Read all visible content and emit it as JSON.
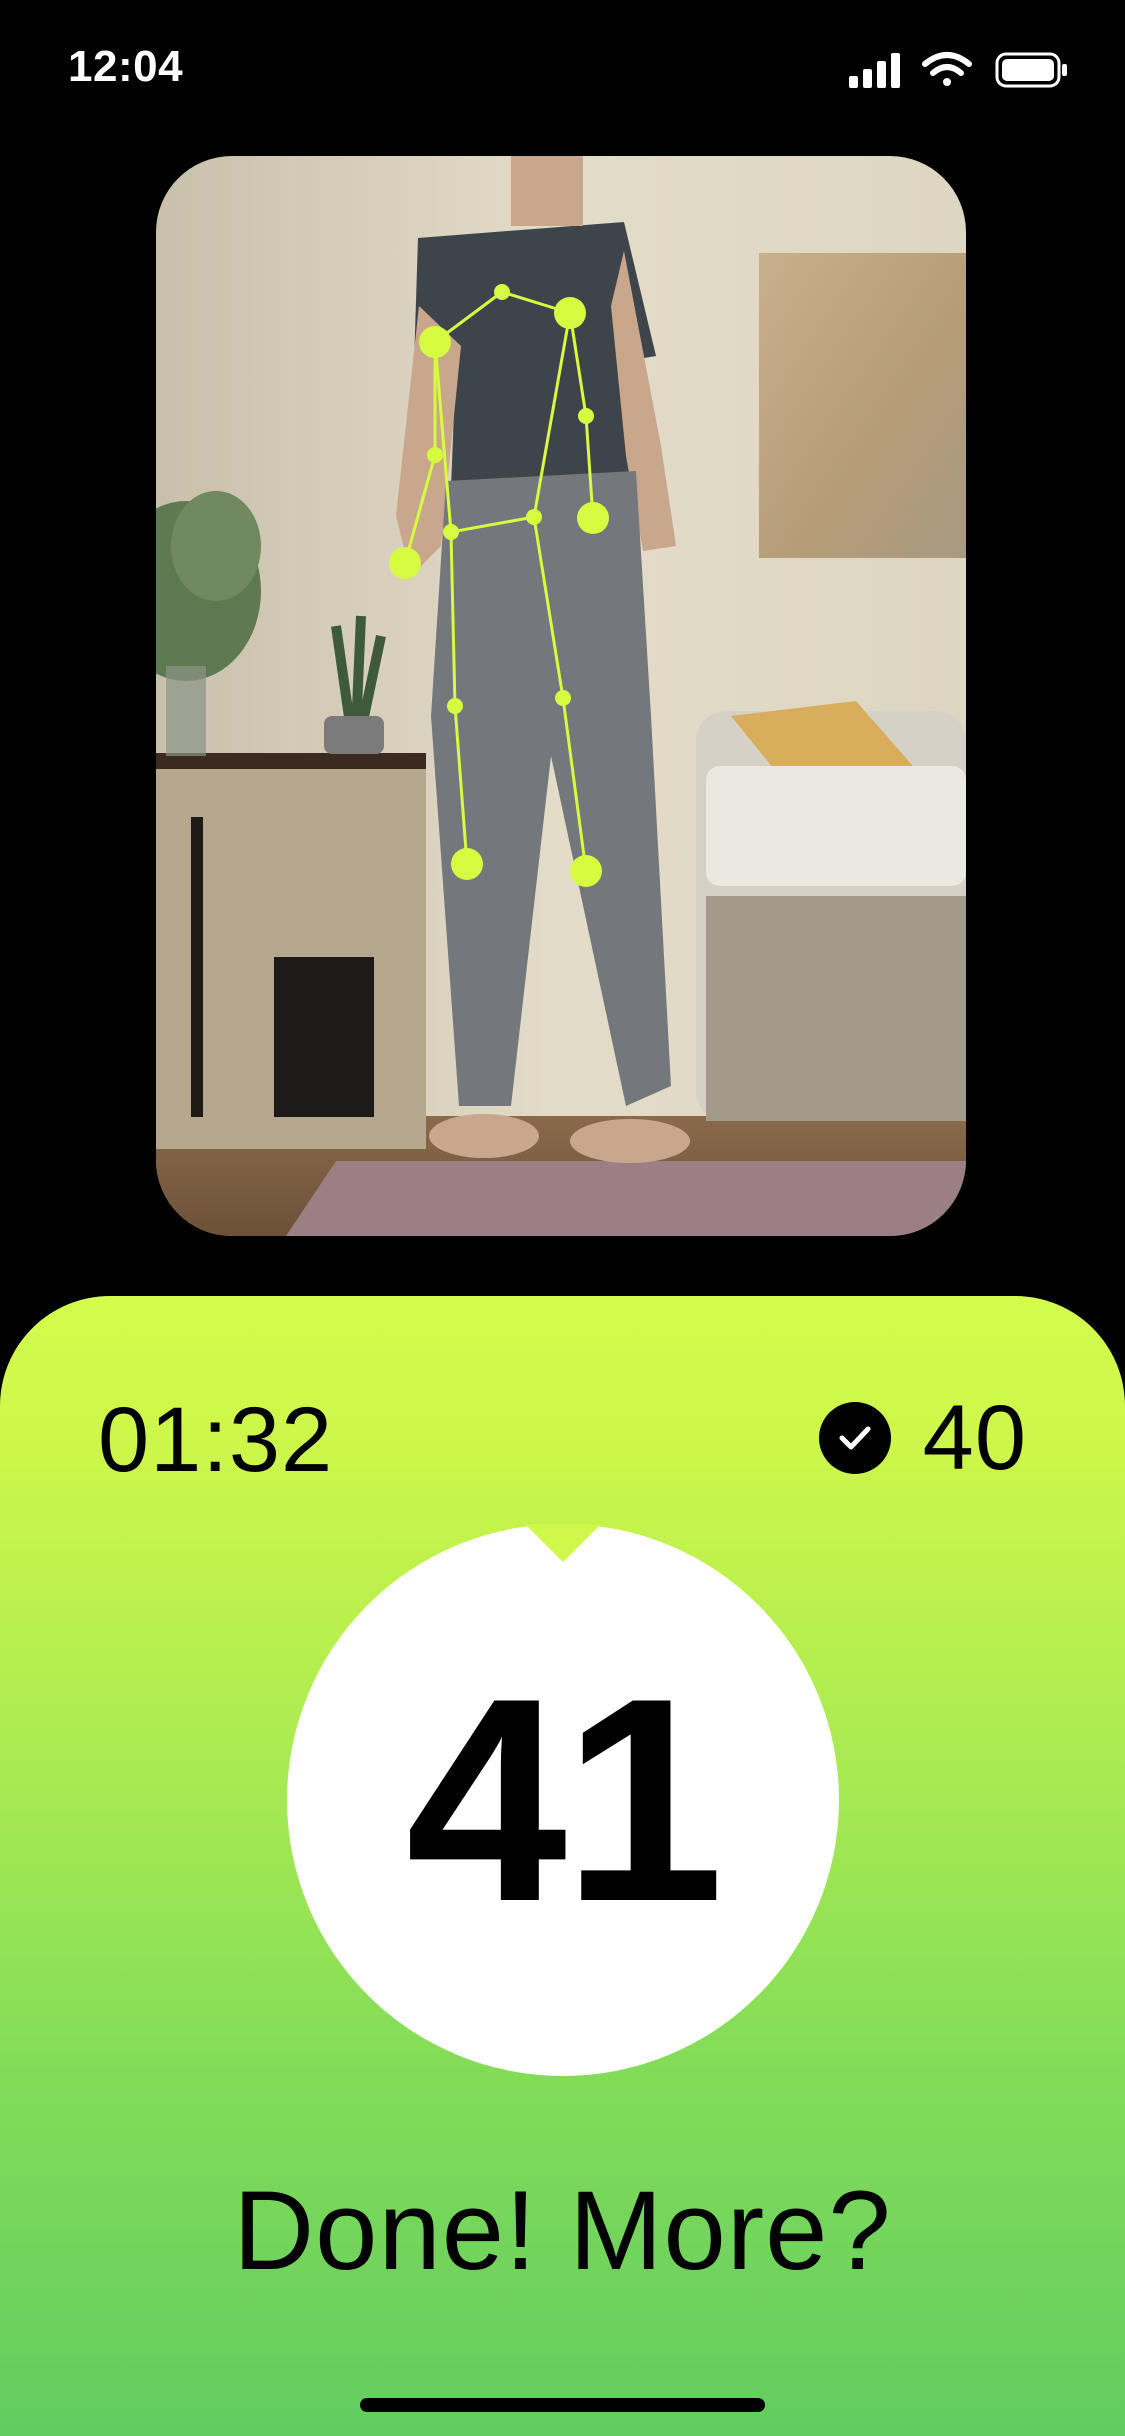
{
  "status_bar": {
    "time": "12:04",
    "icons": [
      "cellular-signal-icon",
      "wifi-icon",
      "battery-icon"
    ]
  },
  "camera_view": {
    "content": "camera-feed-with-pose-skeleton",
    "overlay_color": "#d6fb40"
  },
  "workout": {
    "timer": "01:32",
    "completed_count": "40",
    "current_rep": "41",
    "prompt": "Done! More?"
  },
  "colors": {
    "accent_top": "#d3fc4c",
    "accent_bottom": "#62cc60",
    "background": "#000000"
  }
}
